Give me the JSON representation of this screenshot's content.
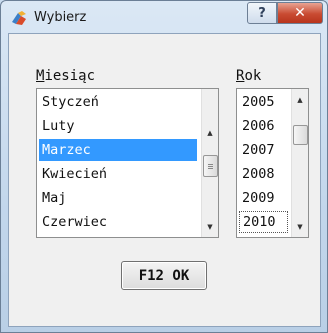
{
  "window": {
    "title": "Wybierz",
    "ghost_title": "",
    "help_label": "?",
    "close_label": "✕"
  },
  "month": {
    "label_accel": "M",
    "label_rest": "iesiąc",
    "items": [
      "Styczeń",
      "Luty",
      "Marzec",
      "Kwiecień",
      "Maj",
      "Czerwiec"
    ],
    "selected": "Marzec"
  },
  "year": {
    "label_accel": "R",
    "label_rest": "ok",
    "items": [
      "2005",
      "2006",
      "2007",
      "2008",
      "2009",
      "2010"
    ],
    "selected": "2010"
  },
  "ok_button": "F12 OK",
  "colors": {
    "selection": "#3399ff",
    "close_button": "#c94b32",
    "background": "#f0f0f0"
  }
}
